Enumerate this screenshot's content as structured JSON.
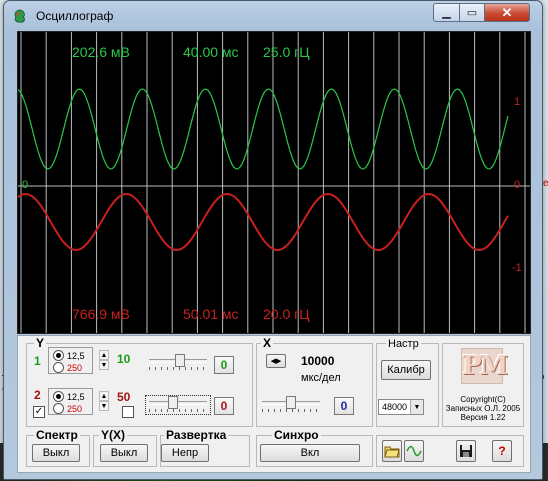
{
  "window": {
    "title": "Осциллограф",
    "close_glyph": "✕",
    "min_glyph": "▁",
    "max_glyph": "▭"
  },
  "background": {
    "frag1": "ли",
    "frag2": "ап",
    "frag3": "д",
    "frag4": "ите"
  },
  "colors": {
    "ch1": "#29c84a",
    "ch2": "#c82020",
    "grid": "#bdbdbd"
  },
  "readouts": {
    "ch1": {
      "voltage": "202.6 мВ",
      "period": "40.00 мс",
      "freq": "25.0 гЦ"
    },
    "ch2": {
      "voltage": "766.9 мВ",
      "period": "50.01 мс",
      "freq": "20.0 гЦ"
    }
  },
  "scale": {
    "plus1": "1",
    "zero_left": "0",
    "zero_right": "0",
    "minus1": "-1"
  },
  "traces": {
    "ch1": {
      "amplitude": 1.0,
      "offset_div": 0,
      "period_div": 2.5,
      "color": "#29c84a"
    },
    "ch2": {
      "amplitude": 0.7,
      "offset_div": 0,
      "period_div": 4.0,
      "color": "#c82020"
    }
  },
  "y_group": {
    "label": "Y",
    "ch1": {
      "num": "1",
      "opt_a": "12,5",
      "opt_b": "250",
      "gain": "10",
      "offset": "0"
    },
    "ch2": {
      "num": "2",
      "opt_a": "12,5",
      "opt_b": "250",
      "gain": "50",
      "offset": "0"
    }
  },
  "x_group": {
    "label": "X",
    "value": "10000",
    "unit": "мкс/дел",
    "offset": "0"
  },
  "settings": {
    "label": "Настр",
    "calib": "Калибр",
    "rate": "48000"
  },
  "copyright": {
    "logo": "PM",
    "line1": "Copyright(C)",
    "line2": "Записных О.Л. 2005",
    "line3": "Версия 1.22"
  },
  "spectrum": {
    "label": "Спектр",
    "button": "Выкл"
  },
  "yx": {
    "label": "Y(X)",
    "button": "Выкл"
  },
  "sweep": {
    "label": "Развертка",
    "button": "Непр"
  },
  "sync": {
    "label": "Синхро",
    "button": "Вкл"
  }
}
